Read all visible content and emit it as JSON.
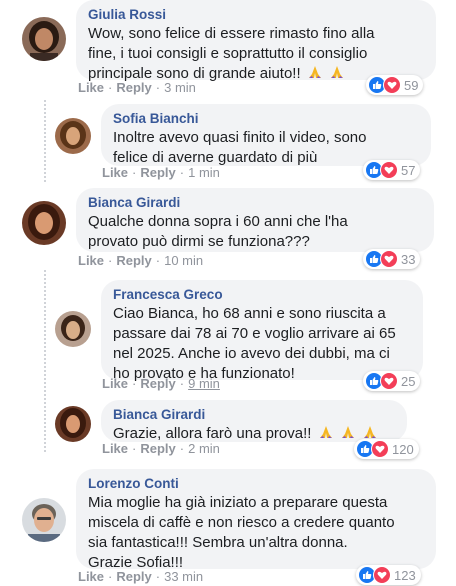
{
  "comments": [
    {
      "name": "Giulia Rossi",
      "lines": [
        "Wow, sono felice di essere rimasto fino alla",
        "fine, i tuoi consigli e soprattutto il consiglio",
        "principale sono di grande aiuto!!"
      ],
      "emoji_count": 2,
      "like": "Like",
      "reply": "Reply",
      "time": "3 min",
      "reactions": "59",
      "avatar": {
        "skin": "#c08866",
        "hair": "#2a1a12",
        "bg": "#8a6a58"
      }
    },
    {
      "name": "Sofia Bianchi",
      "lines": [
        "Inoltre avevo quasi finito il video, sono",
        "felice di averne guardato di più"
      ],
      "emoji_count": 0,
      "like": "Like",
      "reply": "Reply",
      "time": "1 min",
      "reactions": "57",
      "avatar": {
        "skin": "#d8a47a",
        "hair": "#5a3418",
        "bg": "#9c6a4a"
      }
    },
    {
      "name": "Bianca Girardi",
      "lines": [
        "Qualche donna sopra i 60 anni che l'ha",
        "provato può dirmi se funziona???"
      ],
      "emoji_count": 0,
      "like": "Like",
      "reply": "Reply",
      "time": "10 min",
      "reactions": "33",
      "avatar": {
        "skin": "#d99a72",
        "hair": "#3a1a0e",
        "bg": "#6a3a26"
      }
    },
    {
      "name": "Francesca Greco",
      "lines": [
        "Ciao Bianca, ho 68 anni e sono riuscita a",
        "passare dai 78 ai 70 e voglio arrivare ai 65",
        "nel 2025. Anche io avevo dei dubbi, ma ci",
        "ho provato e ha funzionato!"
      ],
      "emoji_count": 0,
      "like": "Like",
      "reply": "Reply",
      "time": "9 min",
      "reactions": "25",
      "avatar": {
        "skin": "#d8ad88",
        "hair": "#3a2418",
        "bg": "#b8a090"
      }
    },
    {
      "name": "Bianca Girardi",
      "lines": [
        "Grazie, allora farò una prova!!"
      ],
      "emoji_count": 3,
      "like": "Like",
      "reply": "Reply",
      "time": "2 min",
      "reactions": "120",
      "avatar": {
        "skin": "#d99a72",
        "hair": "#3a1a0e",
        "bg": "#6a3a26"
      }
    },
    {
      "name": "Lorenzo Conti",
      "lines": [
        "Mia moglie ha già iniziato a preparare questa",
        "miscela di caffè e non riesco a credere quanto",
        "sia fantastica!!! Sembra un'altra donna.",
        "Grazie Sofia!!!"
      ],
      "emoji_count": 0,
      "like": "Like",
      "reply": "Reply",
      "time": "33 min",
      "reactions": "123",
      "avatar": {
        "skin": "#e0b090",
        "hair": "#6a6258",
        "bg": "#d8dce0"
      }
    }
  ],
  "reaction_types": [
    "like-icon",
    "love-icon"
  ],
  "colors": {
    "name": "#385898",
    "bubble": "#f2f3f5",
    "like": "#1877f2",
    "love": "#f33e58",
    "meta": "#90949c"
  }
}
